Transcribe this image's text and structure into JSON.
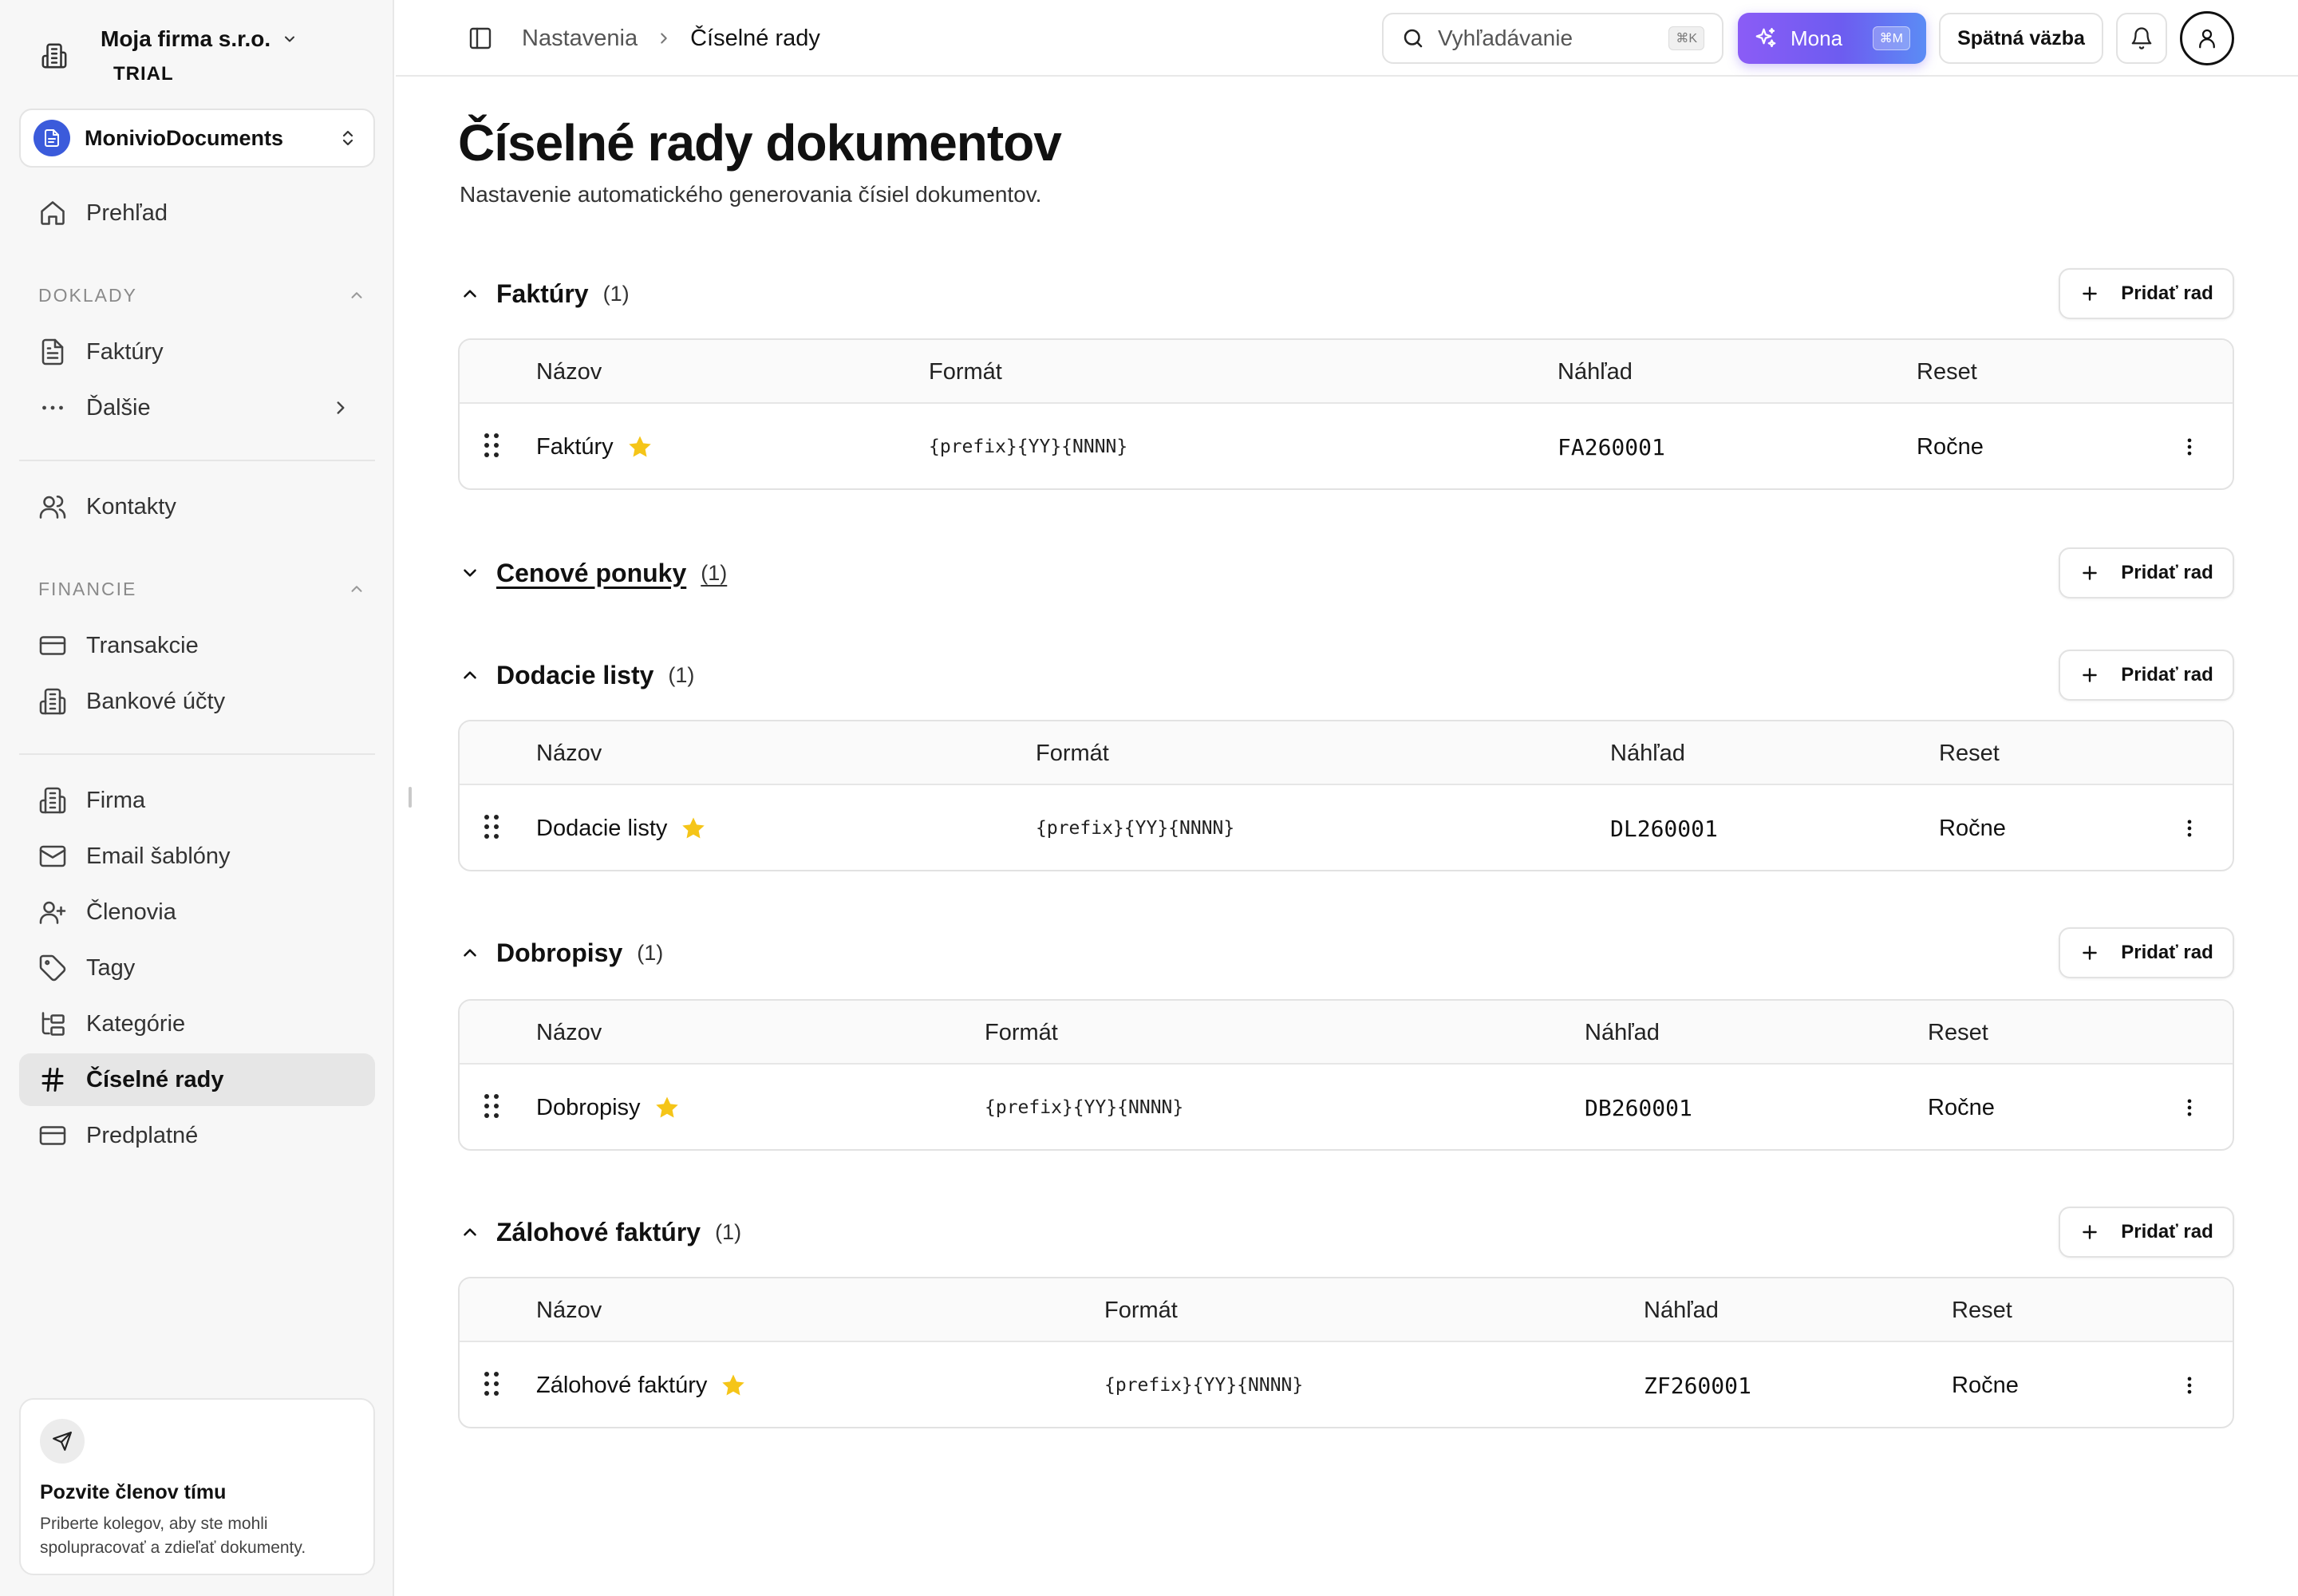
{
  "sidebar": {
    "company_name": "Moja firma s.r.o.",
    "plan": "TRIAL",
    "workspace": "MonivioDocuments",
    "overview": "Prehľad",
    "sections": {
      "doklady": "DOKLADY",
      "financie": "FINANCIE"
    },
    "items": {
      "faktury": "Faktúry",
      "dalsie": "Ďalšie",
      "kontakty": "Kontakty",
      "transakcie": "Transakcie",
      "bankove_ucty": "Bankové účty",
      "firma": "Firma",
      "email_sablony": "Email šablóny",
      "clenovia": "Členovia",
      "tagy": "Tagy",
      "kategorie": "Kategórie",
      "ciselne_rady": "Číselné rady",
      "predplatne": "Predplatné"
    },
    "invite": {
      "title": "Pozvite členov tímu",
      "desc_line1": "Priberte kolegov, aby ste mohli",
      "desc_line2": "spolupracovať a zdieľať dokumenty."
    }
  },
  "topbar": {
    "breadcrumb_parent": "Nastavenia",
    "breadcrumb_current": "Číselné rady",
    "search_placeholder": "Vyhľadávanie",
    "search_shortcut": "⌘K",
    "mona_label": "Mona",
    "mona_shortcut": "⌘M",
    "feedback_label": "Spätná väzba"
  },
  "page": {
    "title": "Číselné rady dokumentov",
    "subtitle": "Nastavenie automatického generovania čísiel dokumentov."
  },
  "add_label": "Pridať rad",
  "columns": {
    "name": "Názov",
    "format": "Formát",
    "preview": "Náhľad",
    "reset": "Reset"
  },
  "groups": [
    {
      "name": "Faktúry",
      "count": "(1)",
      "expanded": true,
      "row": {
        "name": "Faktúry",
        "format": "{prefix}{YY}{NNNN}",
        "preview": "FA260001",
        "reset": "Ročne"
      }
    },
    {
      "name": "Cenové ponuky",
      "count": "(1)",
      "expanded": false
    },
    {
      "name": "Dodacie listy",
      "count": "(1)",
      "expanded": true,
      "row": {
        "name": "Dodacie listy",
        "format": "{prefix}{YY}{NNNN}",
        "preview": "DL260001",
        "reset": "Ročne"
      }
    },
    {
      "name": "Dobropisy",
      "count": "(1)",
      "expanded": true,
      "row": {
        "name": "Dobropisy",
        "format": "{prefix}{YY}{NNNN}",
        "preview": "DB260001",
        "reset": "Ročne"
      }
    },
    {
      "name": "Zálohové faktúry",
      "count": "(1)",
      "expanded": true,
      "row": {
        "name": "Zálohové faktúry",
        "format": "{prefix}{YY}{NNNN}",
        "preview": "ZF260001",
        "reset": "Ročne"
      }
    }
  ],
  "colors": {
    "accent_purple": "#8b5cf6",
    "workspace_blue": "#3b5bdb",
    "star": "#f5c518"
  }
}
